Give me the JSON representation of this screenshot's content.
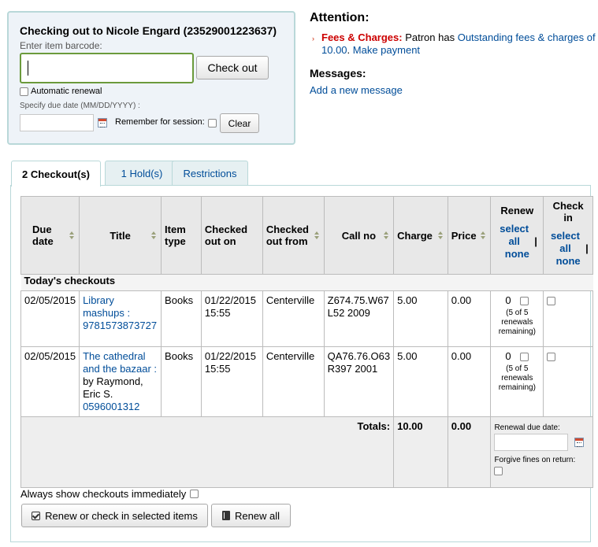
{
  "checkout": {
    "title": "Checking out to Nicole Engard (23529001223637)",
    "barcode_label": "Enter item barcode:",
    "barcode_value": "",
    "checkout_button": "Check out",
    "auto_renew_label": "Automatic renewal",
    "due_date_label": "Specify due date (MM/DD/YYYY) :",
    "due_date_value": "",
    "remember_label": "Remember for session:",
    "clear_button": "Clear"
  },
  "attention": {
    "title": "Attention:",
    "fees_label": "Fees & Charges:",
    "fees_text": " Patron has ",
    "fees_link": "Outstanding fees & charges of 10.00",
    "fees_sep": ". ",
    "payment_link": "Make payment",
    "messages_title": "Messages:",
    "add_message_link": "Add a new message"
  },
  "tabs": [
    {
      "label": "2 Checkout(s)",
      "active": true
    },
    {
      "label": "1 Hold(s)",
      "active": false
    },
    {
      "label": "Restrictions",
      "active": false
    }
  ],
  "table": {
    "headers": {
      "due_date": "Due date",
      "title": "Title",
      "item_type": "Item type",
      "checked_out_on": "Checked out on",
      "checked_out_from": "Checked out from",
      "call_no": "Call no",
      "charge": "Charge",
      "price": "Price",
      "renew": "Renew",
      "check_in": "Check in",
      "select_all": "select all",
      "separator": " | ",
      "none": "none"
    },
    "group_label": "Today's checkouts",
    "rows": [
      {
        "due_date": "02/05/2015",
        "title_link": "Library mashups :",
        "title_extra": "",
        "isbn": "9781573873727",
        "item_type": "Books",
        "checked_out_on": "01/22/2015 15:55",
        "checked_out_from": "Centerville",
        "call_no": "Z674.75.W67 L52 2009",
        "charge": "5.00",
        "price": "0.00",
        "renew_count": "0",
        "renew_note": "(5 of 5 renewals remaining)"
      },
      {
        "due_date": "02/05/2015",
        "title_link": "The cathedral and the bazaar :",
        "title_extra": "by Raymond, Eric S.",
        "isbn": "0596001312",
        "item_type": "Books",
        "checked_out_on": "01/22/2015 15:55",
        "checked_out_from": "Centerville",
        "call_no": "QA76.76.O63 R397 2001",
        "charge": "5.00",
        "price": "0.00",
        "renew_count": "0",
        "renew_note": "(5 of 5 renewals remaining)"
      }
    ],
    "totals": {
      "label": "Totals:",
      "charge": "10.00",
      "price": "0.00",
      "renewal_due_label": "Renewal due date:",
      "forgive_label": "Forgive fines on return:"
    }
  },
  "bottom": {
    "always_show_label": "Always show checkouts immediately",
    "renew_checkin_button": "Renew or check in selected items",
    "renew_all_button": "Renew all"
  }
}
